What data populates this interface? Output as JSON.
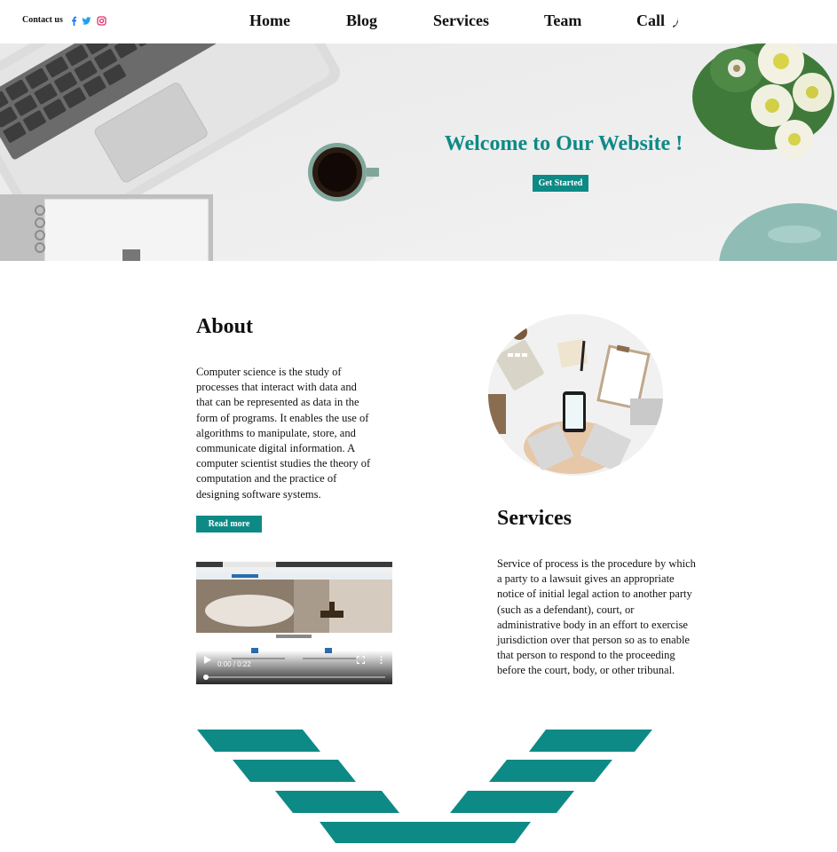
{
  "header": {
    "contact_label": "Contact us",
    "social_icons": [
      "facebook-icon",
      "twitter-icon",
      "instagram-icon"
    ],
    "nav": [
      "Home",
      "Blog",
      "Services",
      "Team",
      "Call"
    ],
    "call_icon": "phone-icon"
  },
  "hero": {
    "title": "Welcome to Our Website !",
    "button": "Get Started"
  },
  "about": {
    "title": "About",
    "text": "Computer science is the study of processes that interact with data and that can be represented as data in the form of programs. It enables the use of algorithms to manipulate, store, and communicate digital information. A computer scientist studies the theory of computation and the practice of designing software systems.",
    "button": "Read more"
  },
  "video": {
    "time": "0:00 / 0:22"
  },
  "services": {
    "title": "Services",
    "text": "Service of process is the procedure by which a party to a lawsuit gives an appropriate notice of initial legal action to another party (such as a defendant), court, or administrative body in an effort to exercise jurisdiction over that person so as to enable that person to respond to the proceeding before the court, body, or other tribunal."
  },
  "colors": {
    "accent": "#0e8a86",
    "facebook": "#1877f2",
    "twitter": "#1da1f2",
    "instagram": "#e1306c"
  }
}
